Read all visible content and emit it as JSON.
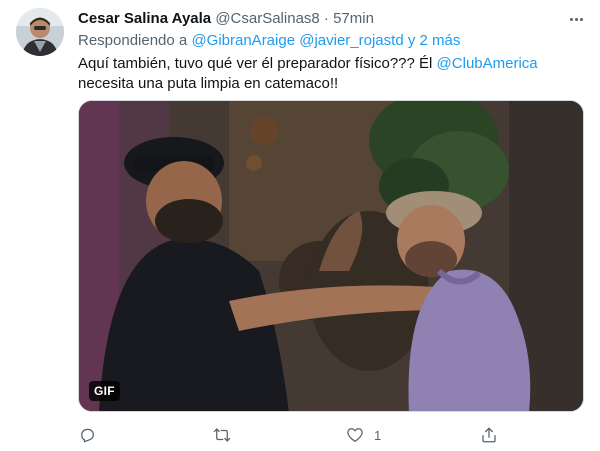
{
  "tweet": {
    "display_name": "Cesar Salina Ayala",
    "handle": "@CsarSalinas8",
    "separator": "·",
    "time": "57min",
    "reply_prefix": "Respondiendo a",
    "reply_mentions": [
      "@GibranAraige",
      "@javier_rojastd"
    ],
    "reply_more": "y 2 más",
    "text_part1": "Aquí también, tuvo qué ver él preparador físico??? Él ",
    "text_mention": "@ClubAmerica",
    "text_part2": " necesita una puta limpia en catemaco!!",
    "media_badge": "GIF",
    "like_count": "1"
  },
  "colors": {
    "link": "#1d9bf0",
    "secondary_text": "#536471",
    "primary_text": "#0f1419"
  },
  "icons": {
    "reply": "reply-icon",
    "retweet": "retweet-icon",
    "like": "heart-icon",
    "share": "share-icon",
    "more": "more-icon"
  }
}
